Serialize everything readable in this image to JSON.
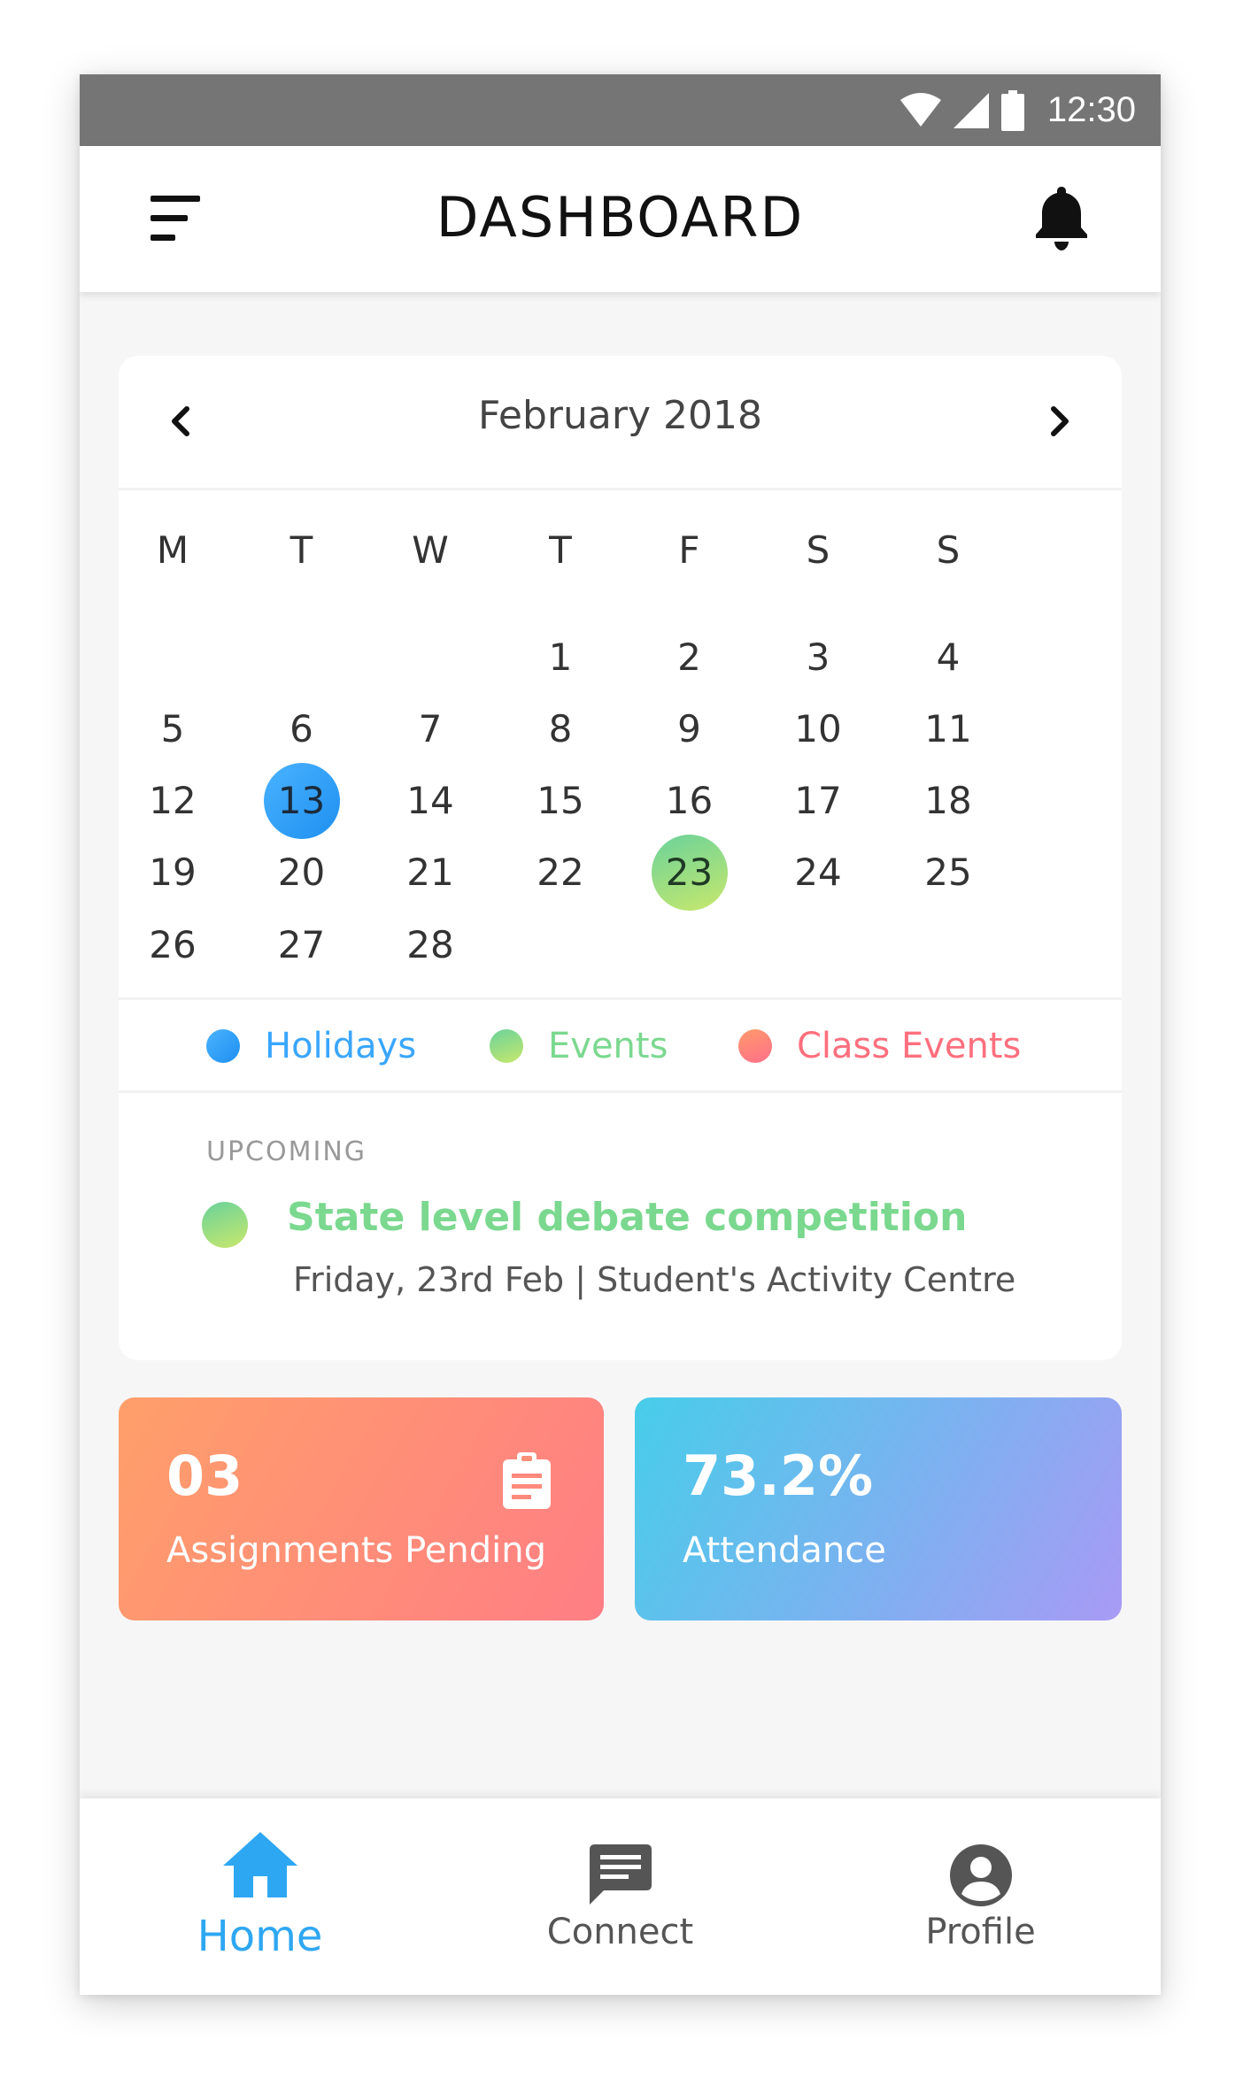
{
  "status_bar": {
    "time": "12:30",
    "icons": [
      "wifi-icon",
      "signal-icon",
      "battery-icon"
    ]
  },
  "app_bar": {
    "title": "DASHBOARD",
    "menu_icon": "menu-icon",
    "notification_icon": "bell-icon"
  },
  "calendar": {
    "month_label": "February 2018",
    "prev_icon": "chevron-left-icon",
    "next_icon": "chevron-right-icon",
    "weekdays": [
      "M",
      "T",
      "W",
      "T",
      "F",
      "S",
      "S"
    ],
    "weeks": [
      [
        "",
        "",
        "",
        "1",
        "2",
        "3",
        "4"
      ],
      [
        "5",
        "6",
        "7",
        "8",
        "9",
        "10",
        "11"
      ],
      [
        "12",
        "13",
        "14",
        "15",
        "16",
        "17",
        "18"
      ],
      [
        "19",
        "20",
        "21",
        "22",
        "23",
        "24",
        "25"
      ],
      [
        "26",
        "27",
        "28",
        "",
        "",
        "",
        ""
      ]
    ],
    "highlighted": {
      "13": "holiday",
      "23": "event"
    },
    "legend": [
      {
        "label": "Holidays",
        "color": "#3aa6ff",
        "text_color": "#3aa6ff"
      },
      {
        "label": "Events",
        "color": "#7ad88c",
        "text_color": "#7bd88f"
      },
      {
        "label": "Class Events",
        "color": "#ff7a7a",
        "text_color": "#ff6f7d"
      }
    ]
  },
  "upcoming": {
    "caption": "UPCOMING",
    "title": "State level debate competition",
    "details": "Friday, 23rd Feb | Student's Activity Centre"
  },
  "tiles": {
    "assignments": {
      "value": "03",
      "label": "Assignments Pending",
      "icon": "clipboard-icon"
    },
    "attendance": {
      "value": "73.2%",
      "label": "Attendance"
    }
  },
  "bottom_nav": [
    {
      "label": "Home",
      "icon": "home-icon",
      "active": true
    },
    {
      "label": "Connect",
      "icon": "chat-icon",
      "active": false
    },
    {
      "label": "Profile",
      "icon": "account-icon",
      "active": false
    }
  ],
  "colors": {
    "accent": "#2ea7f2",
    "inactive": "#555555",
    "status_bar": "#757575"
  }
}
